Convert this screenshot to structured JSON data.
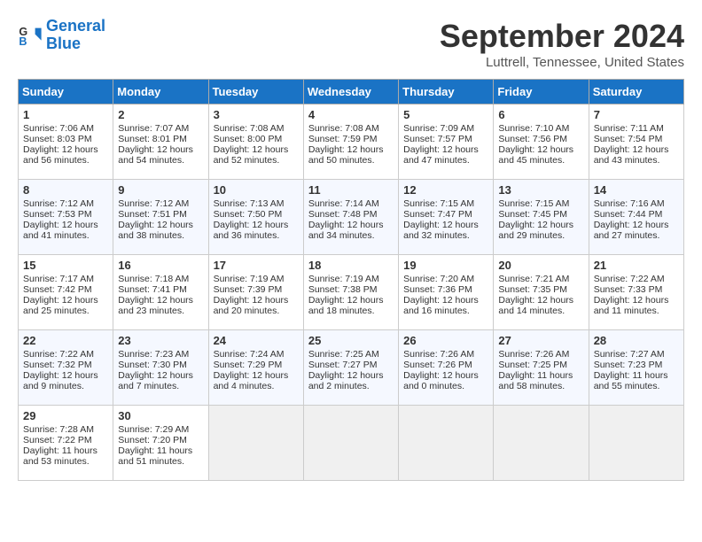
{
  "logo": {
    "line1": "General",
    "line2": "Blue"
  },
  "title": "September 2024",
  "location": "Luttrell, Tennessee, United States",
  "headers": [
    "Sunday",
    "Monday",
    "Tuesday",
    "Wednesday",
    "Thursday",
    "Friday",
    "Saturday"
  ],
  "weeks": [
    [
      {
        "day": "1",
        "info": "Sunrise: 7:06 AM\nSunset: 8:03 PM\nDaylight: 12 hours\nand 56 minutes."
      },
      {
        "day": "2",
        "info": "Sunrise: 7:07 AM\nSunset: 8:01 PM\nDaylight: 12 hours\nand 54 minutes."
      },
      {
        "day": "3",
        "info": "Sunrise: 7:08 AM\nSunset: 8:00 PM\nDaylight: 12 hours\nand 52 minutes."
      },
      {
        "day": "4",
        "info": "Sunrise: 7:08 AM\nSunset: 7:59 PM\nDaylight: 12 hours\nand 50 minutes."
      },
      {
        "day": "5",
        "info": "Sunrise: 7:09 AM\nSunset: 7:57 PM\nDaylight: 12 hours\nand 47 minutes."
      },
      {
        "day": "6",
        "info": "Sunrise: 7:10 AM\nSunset: 7:56 PM\nDaylight: 12 hours\nand 45 minutes."
      },
      {
        "day": "7",
        "info": "Sunrise: 7:11 AM\nSunset: 7:54 PM\nDaylight: 12 hours\nand 43 minutes."
      }
    ],
    [
      {
        "day": "8",
        "info": "Sunrise: 7:12 AM\nSunset: 7:53 PM\nDaylight: 12 hours\nand 41 minutes."
      },
      {
        "day": "9",
        "info": "Sunrise: 7:12 AM\nSunset: 7:51 PM\nDaylight: 12 hours\nand 38 minutes."
      },
      {
        "day": "10",
        "info": "Sunrise: 7:13 AM\nSunset: 7:50 PM\nDaylight: 12 hours\nand 36 minutes."
      },
      {
        "day": "11",
        "info": "Sunrise: 7:14 AM\nSunset: 7:48 PM\nDaylight: 12 hours\nand 34 minutes."
      },
      {
        "day": "12",
        "info": "Sunrise: 7:15 AM\nSunset: 7:47 PM\nDaylight: 12 hours\nand 32 minutes."
      },
      {
        "day": "13",
        "info": "Sunrise: 7:15 AM\nSunset: 7:45 PM\nDaylight: 12 hours\nand 29 minutes."
      },
      {
        "day": "14",
        "info": "Sunrise: 7:16 AM\nSunset: 7:44 PM\nDaylight: 12 hours\nand 27 minutes."
      }
    ],
    [
      {
        "day": "15",
        "info": "Sunrise: 7:17 AM\nSunset: 7:42 PM\nDaylight: 12 hours\nand 25 minutes."
      },
      {
        "day": "16",
        "info": "Sunrise: 7:18 AM\nSunset: 7:41 PM\nDaylight: 12 hours\nand 23 minutes."
      },
      {
        "day": "17",
        "info": "Sunrise: 7:19 AM\nSunset: 7:39 PM\nDaylight: 12 hours\nand 20 minutes."
      },
      {
        "day": "18",
        "info": "Sunrise: 7:19 AM\nSunset: 7:38 PM\nDaylight: 12 hours\nand 18 minutes."
      },
      {
        "day": "19",
        "info": "Sunrise: 7:20 AM\nSunset: 7:36 PM\nDaylight: 12 hours\nand 16 minutes."
      },
      {
        "day": "20",
        "info": "Sunrise: 7:21 AM\nSunset: 7:35 PM\nDaylight: 12 hours\nand 14 minutes."
      },
      {
        "day": "21",
        "info": "Sunrise: 7:22 AM\nSunset: 7:33 PM\nDaylight: 12 hours\nand 11 minutes."
      }
    ],
    [
      {
        "day": "22",
        "info": "Sunrise: 7:22 AM\nSunset: 7:32 PM\nDaylight: 12 hours\nand 9 minutes."
      },
      {
        "day": "23",
        "info": "Sunrise: 7:23 AM\nSunset: 7:30 PM\nDaylight: 12 hours\nand 7 minutes."
      },
      {
        "day": "24",
        "info": "Sunrise: 7:24 AM\nSunset: 7:29 PM\nDaylight: 12 hours\nand 4 minutes."
      },
      {
        "day": "25",
        "info": "Sunrise: 7:25 AM\nSunset: 7:27 PM\nDaylight: 12 hours\nand 2 minutes."
      },
      {
        "day": "26",
        "info": "Sunrise: 7:26 AM\nSunset: 7:26 PM\nDaylight: 12 hours\nand 0 minutes."
      },
      {
        "day": "27",
        "info": "Sunrise: 7:26 AM\nSunset: 7:25 PM\nDaylight: 11 hours\nand 58 minutes."
      },
      {
        "day": "28",
        "info": "Sunrise: 7:27 AM\nSunset: 7:23 PM\nDaylight: 11 hours\nand 55 minutes."
      }
    ],
    [
      {
        "day": "29",
        "info": "Sunrise: 7:28 AM\nSunset: 7:22 PM\nDaylight: 11 hours\nand 53 minutes."
      },
      {
        "day": "30",
        "info": "Sunrise: 7:29 AM\nSunset: 7:20 PM\nDaylight: 11 hours\nand 51 minutes."
      },
      {
        "day": "",
        "info": ""
      },
      {
        "day": "",
        "info": ""
      },
      {
        "day": "",
        "info": ""
      },
      {
        "day": "",
        "info": ""
      },
      {
        "day": "",
        "info": ""
      }
    ]
  ]
}
